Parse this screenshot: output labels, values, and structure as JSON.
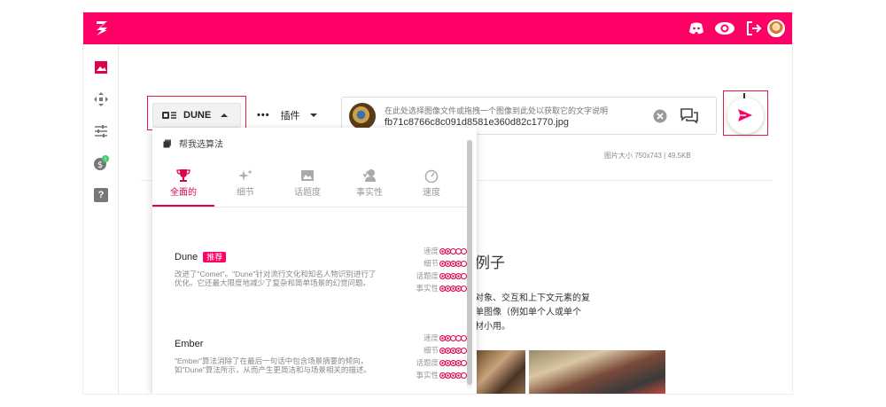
{
  "colors": {
    "brand": "#ff0066",
    "accent": "#e00050",
    "highlight_box": "#e21b3c"
  },
  "topbar": {
    "icons": [
      "logo-icon",
      "discord-icon",
      "eye-icon",
      "logout-icon",
      "avatar"
    ]
  },
  "sidebar": {
    "items": [
      {
        "icon": "image-icon"
      },
      {
        "icon": "move-icon"
      },
      {
        "icon": "sliders-icon"
      },
      {
        "icon": "dollar-icon"
      },
      {
        "icon": "help-icon",
        "label": "?"
      }
    ]
  },
  "toolbar": {
    "algorithm_button": "DUNE",
    "plugin_button": "插件"
  },
  "upload": {
    "hint": "在此处选择图像文件或拖拽一个图像到此处以获取它的文字说明",
    "filename": "fb71c8766c8c091d8581e360d82c1770.jpg",
    "size_info": "图片大小 750x743 | 49.5KB"
  },
  "background_page": {
    "heading": "例子",
    "lines": [
      "对象、交互和上下文元素的复",
      "单图像（例如单个人或单个",
      "材小用。"
    ]
  },
  "dropdown": {
    "help_label": "帮我选算法",
    "tabs": [
      {
        "label": "全面的",
        "icon": "trophy-icon",
        "active": true
      },
      {
        "label": "细节",
        "icon": "sparkle-icon",
        "active": false
      },
      {
        "label": "话题度",
        "icon": "image-frame-icon",
        "active": false
      },
      {
        "label": "事实性",
        "icon": "person-check-icon",
        "active": false
      },
      {
        "label": "速度",
        "icon": "speedometer-icon",
        "active": false
      }
    ],
    "algorithms": [
      {
        "name": "Dune",
        "badge": "推荐",
        "description": "改进了\"Comet\"。\"Dune\"针对流行文化和知名人物识别进行了优化。它还最大限度地减少了复杂和简单场景的幻觉问题。",
        "metrics": [
          {
            "label": "速度",
            "value": 2,
            "max": 5
          },
          {
            "label": "细节",
            "value": 4,
            "max": 5
          },
          {
            "label": "话题度",
            "value": 4,
            "max": 5
          },
          {
            "label": "事实性",
            "value": 4,
            "max": 5
          }
        ]
      },
      {
        "name": "Ember",
        "badge": "",
        "description": "\"Ember\"算法消除了在最后一句话中包含场景摘要的倾向，如\"Dune\"算法所示，从而产生更简洁和与场景相关的描述。",
        "metrics": [
          {
            "label": "速度",
            "value": 2,
            "max": 5
          },
          {
            "label": "细节",
            "value": 4,
            "max": 5
          },
          {
            "label": "话题度",
            "value": 4,
            "max": 5
          },
          {
            "label": "事实性",
            "value": 4,
            "max": 5
          }
        ]
      }
    ]
  }
}
